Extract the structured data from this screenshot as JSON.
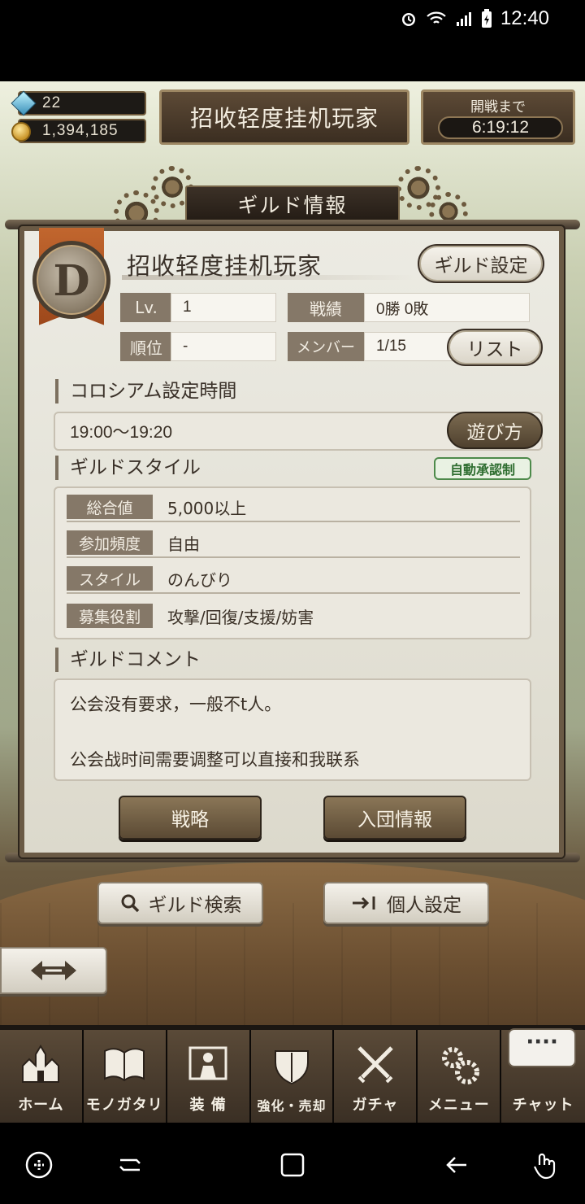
{
  "status": {
    "time": "12:40"
  },
  "hud": {
    "gems": "22",
    "coins": "1,394,185",
    "title": "招收轻度挂机玩家",
    "battle_label": "開戦まで",
    "battle_timer": "6:19:12"
  },
  "panel": {
    "header": "ギルド情報",
    "rank": "D",
    "guild_name": "招收轻度挂机玩家",
    "settings_button": "ギルド設定",
    "stats": {
      "lv_label": "Lv.",
      "lv_value": "1",
      "record_label": "戦績",
      "record_value": "0勝 0敗",
      "rank_label": "順位",
      "rank_value": "-",
      "member_label": "メンバー",
      "member_value": "1/15",
      "list_button": "リスト"
    },
    "colosseum": {
      "title": "コロシアム設定時間",
      "time": "19:00〜19:20",
      "howto_button": "遊び方"
    },
    "style": {
      "title": "ギルドスタイル",
      "badge": "自動承認制",
      "rows": [
        {
          "key": "総合値",
          "value": "5,000以上"
        },
        {
          "key": "参加頻度",
          "value": "自由"
        },
        {
          "key": "スタイル",
          "value": "のんびり"
        },
        {
          "key": "募集役割",
          "value": "攻撃/回復/支援/妨害"
        }
      ]
    },
    "comment": {
      "title": "ギルドコメント",
      "line1": "公会没有要求，一般不t人。",
      "line2": "公会战时间需要调整可以直接和我联系"
    },
    "strategy_button": "戦略",
    "join_info_button": "入団情報"
  },
  "actions": {
    "search_button": "ギルド検索",
    "personal_button": "個人設定"
  },
  "tabs": [
    {
      "label": "ホーム",
      "icon": "castle-icon"
    },
    {
      "label": "モノガタリ",
      "icon": "book-icon"
    },
    {
      "label": "装 備",
      "icon": "armor-icon"
    },
    {
      "label": "強化・売却",
      "icon": "shield-icon"
    },
    {
      "label": "ガチャ",
      "icon": "swords-icon"
    },
    {
      "label": "メニュー",
      "icon": "gears-icon"
    },
    {
      "label": "チャット",
      "icon": "chat-bubble-icon",
      "bubble": "····"
    }
  ],
  "colors": {
    "panel_border": "#6a5a45",
    "label_bg": "#857868",
    "accent_green": "#4d8a4a"
  }
}
